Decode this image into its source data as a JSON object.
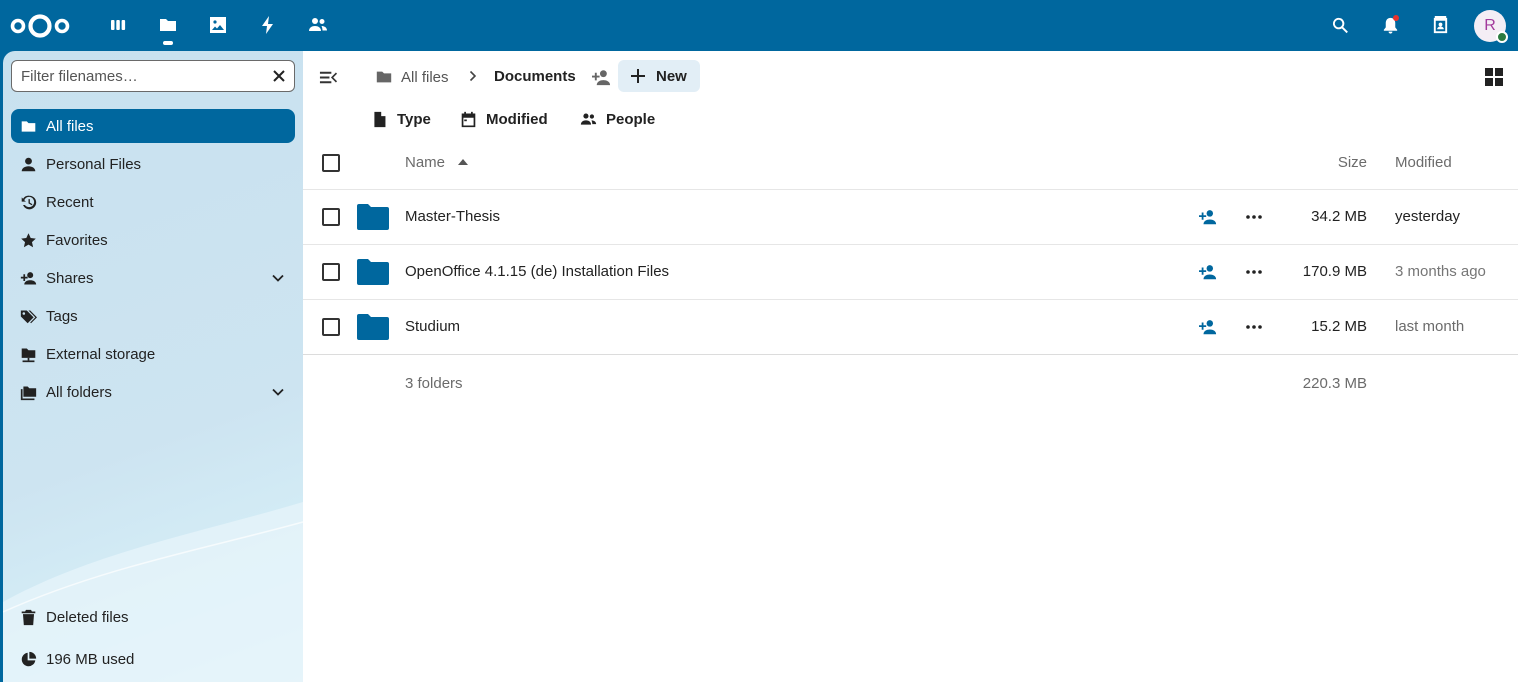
{
  "header": {
    "apps": [
      {
        "name": "dashboard",
        "icon": "dashboard-icon"
      },
      {
        "name": "files",
        "icon": "folder-icon",
        "active": true
      },
      {
        "name": "photos",
        "icon": "image-icon"
      },
      {
        "name": "activity",
        "icon": "lightning-icon"
      },
      {
        "name": "contacts",
        "icon": "contacts-icon"
      }
    ],
    "avatar_initial": "R"
  },
  "sidebar": {
    "filter_placeholder": "Filter filenames…",
    "items": [
      {
        "label": "All files",
        "icon": "folder-icon",
        "active": true
      },
      {
        "label": "Personal Files",
        "icon": "person-icon"
      },
      {
        "label": "Recent",
        "icon": "history-icon"
      },
      {
        "label": "Favorites",
        "icon": "star-icon"
      },
      {
        "label": "Shares",
        "icon": "share-icon",
        "expandable": true
      },
      {
        "label": "Tags",
        "icon": "tag-icon"
      },
      {
        "label": "External storage",
        "icon": "external-storage-icon"
      },
      {
        "label": "All folders",
        "icon": "folders-icon",
        "expandable": true
      }
    ],
    "deleted_files": "Deleted files",
    "quota": "196 MB used"
  },
  "breadcrumb": {
    "root": "All files",
    "current": "Documents"
  },
  "toolbar": {
    "new_label": "New"
  },
  "filters": {
    "type": "Type",
    "modified": "Modified",
    "people": "People"
  },
  "table": {
    "columns": {
      "name": "Name",
      "size": "Size",
      "modified": "Modified"
    },
    "rows": [
      {
        "name": "Master-Thesis",
        "size": "34.2 MB",
        "modified": "yesterday",
        "modified_color": "#222222"
      },
      {
        "name": "OpenOffice 4.1.15 (de) Installation Files",
        "size": "170.9 MB",
        "modified": "3 months ago",
        "modified_color": "#767676"
      },
      {
        "name": "Studium",
        "size": "15.2 MB",
        "modified": "last month",
        "modified_color": "#6b6b6b"
      }
    ],
    "summary_count": "3 folders",
    "summary_size": "220.3 MB"
  },
  "colors": {
    "primary": "#00679e",
    "folder": "#00679e"
  }
}
